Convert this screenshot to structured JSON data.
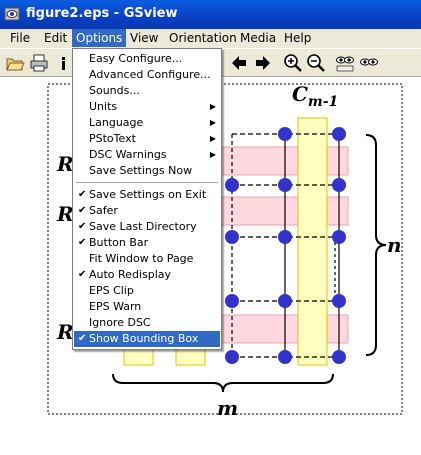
{
  "window": {
    "title": "figure2.eps - GSview",
    "app_icon": "gsview-app-icon"
  },
  "menubar": [
    "File",
    "Edit",
    "Options",
    "View",
    "Orientation",
    "Media",
    "Help"
  ],
  "active_menu": "Options",
  "options_menu": {
    "group1": [
      {
        "label": "Easy Configure...",
        "submenu": false
      },
      {
        "label": "Advanced Configure...",
        "submenu": false
      },
      {
        "label": "Sounds...",
        "submenu": false
      },
      {
        "label": "Units",
        "submenu": true
      },
      {
        "label": "Language",
        "submenu": true
      },
      {
        "label": "PStoText",
        "submenu": true
      },
      {
        "label": "DSC Warnings",
        "submenu": true
      },
      {
        "label": "Save Settings Now",
        "submenu": false
      }
    ],
    "group2": [
      {
        "label": "Save Settings on Exit",
        "checked": true
      },
      {
        "label": "Safer",
        "checked": true
      },
      {
        "label": "Save Last Directory",
        "checked": true
      },
      {
        "label": "Button Bar",
        "checked": true
      },
      {
        "label": "Fit Window to Page",
        "checked": false
      },
      {
        "label": "Auto Redisplay",
        "checked": true
      },
      {
        "label": "EPS Clip",
        "checked": false
      },
      {
        "label": "EPS Warn",
        "checked": false
      },
      {
        "label": "Ignore DSC",
        "checked": false
      },
      {
        "label": "Show Bounding Box",
        "checked": true,
        "highlighted": true
      }
    ]
  },
  "figure": {
    "col_label": "C",
    "col_subscript": "m-1",
    "row_label": "R",
    "brace_right_label": "n",
    "brace_bottom_label": "m"
  },
  "colors": {
    "title_bar": "#0a3fc4",
    "menu_highlight": "#316ac5",
    "node_fill": "#3333cc",
    "column_fill": "#ffffc0",
    "column_stroke": "#e8c000",
    "row_fill": "#ffd8e0",
    "row_stroke": "#f0a0b0"
  }
}
